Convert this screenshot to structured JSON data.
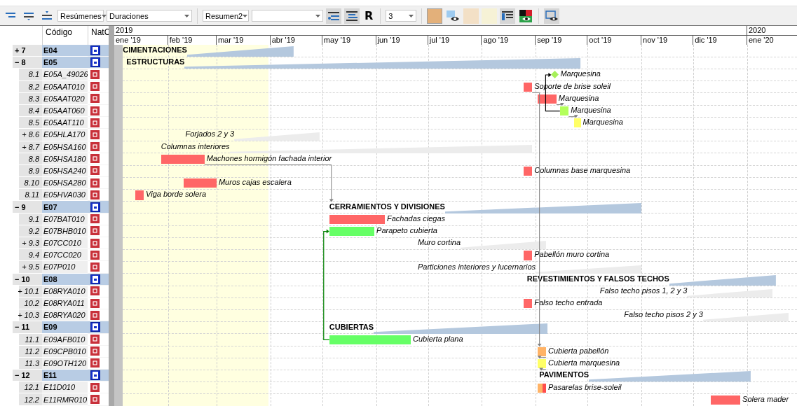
{
  "toolbar": [
    {
      "kind": "icon"
    },
    {
      "kind": "icon"
    },
    {
      "kind": "icon"
    },
    {
      "kind": "select",
      "value": "Resúmenes"
    },
    {
      "kind": "select",
      "value": "Duraciones"
    },
    {
      "kind": "separator"
    },
    {
      "kind": "select",
      "value": "Resumen2"
    },
    {
      "kind": "select"
    },
    {
      "kind": "icon",
      "pressed": true
    },
    {
      "kind": "icon",
      "pressed": true
    },
    {
      "kind": "letter",
      "label": "R"
    },
    {
      "kind": "separator"
    },
    {
      "kind": "select",
      "value": "3"
    },
    {
      "kind": "separator"
    },
    {
      "kind": "swatch",
      "color": "#e3b07a",
      "pressed": true
    },
    {
      "kind": "icon"
    },
    {
      "kind": "swatch",
      "color": "#f3e0c6"
    },
    {
      "kind": "swatch",
      "color": "#f6f2d6"
    },
    {
      "kind": "icon",
      "pressed": true
    },
    {
      "kind": "icon"
    },
    {
      "kind": "separator"
    },
    {
      "kind": "icon",
      "pressed": true
    }
  ],
  "columns": [
    {
      "label": "Código"
    },
    {
      "label": "NatC"
    }
  ],
  "timeline": {
    "years": [
      {
        "label": "2019"
      },
      {
        "label": "2020"
      }
    ],
    "months": [
      {
        "label": "ene '19"
      },
      {
        "label": "feb '19"
      },
      {
        "label": "mar '19"
      },
      {
        "label": "abr '19"
      },
      {
        "label": "may '19"
      },
      {
        "label": "jun '19"
      },
      {
        "label": "jul '19"
      },
      {
        "label": "ago '19"
      },
      {
        "label": "sep '19"
      },
      {
        "label": "oct '19"
      },
      {
        "label": "nov '19"
      },
      {
        "label": "dic '19"
      },
      {
        "label": "ene '20"
      }
    ]
  },
  "rows": [
    {
      "num": "7",
      "code": "E04",
      "expander": "+",
      "kind": "chapter",
      "bar": {
        "kind": "phase",
        "label": "CIMENTACIONES"
      }
    },
    {
      "num": "8",
      "code": "E05",
      "expander": "−",
      "kind": "chapter",
      "bar": {
        "kind": "phase",
        "label": "ESTRUCTURAS"
      }
    },
    {
      "num": "8.1",
      "code": "E05A_49026",
      "kind": "task",
      "bar": {
        "kind": "milestone",
        "color": "#a6f05a",
        "label": "Marquesina"
      }
    },
    {
      "num": "8.2",
      "code": "E05AAT010",
      "kind": "task",
      "bar": {
        "kind": "task",
        "color": "#ff6666",
        "label": "Soporte de brise soleil"
      }
    },
    {
      "num": "8.3",
      "code": "E05AAT020",
      "kind": "task",
      "bar": {
        "kind": "task",
        "color": "#ff6666",
        "label": "Marquesina"
      }
    },
    {
      "num": "8.4",
      "code": "E05AAT060",
      "kind": "task",
      "bar": {
        "kind": "task",
        "color": "#b3ff5a",
        "label": "Marquesina"
      }
    },
    {
      "num": "8.5",
      "code": "E05AAT110",
      "kind": "task",
      "bar": {
        "kind": "task",
        "color": "#ffff66",
        "label": "Marquesina"
      }
    },
    {
      "num": "8.6",
      "code": "E05HLA170",
      "expander": "+",
      "kind": "task",
      "bar": {
        "kind": "group",
        "label": "Forjados 2 y 3"
      }
    },
    {
      "num": "8.7",
      "code": "E05HSA160",
      "expander": "+",
      "kind": "task",
      "bar": {
        "kind": "group",
        "label": "Columnas interiores"
      }
    },
    {
      "num": "8.8",
      "code": "E05HSA180",
      "kind": "task",
      "bar": {
        "kind": "task",
        "color": "#ff6666",
        "label": "Machones hormigón fachada interior"
      }
    },
    {
      "num": "8.9",
      "code": "E05HSA240",
      "kind": "task",
      "bar": {
        "kind": "task",
        "color": "#ff6666",
        "label": "Columnas base marquesina"
      }
    },
    {
      "num": "8.10",
      "code": "E05HSA280",
      "kind": "task",
      "bar": {
        "kind": "task",
        "color": "#ff6666",
        "label": "Muros cajas escalera"
      }
    },
    {
      "num": "8.11",
      "code": "E05HVA030",
      "kind": "task",
      "bar": {
        "kind": "task",
        "color": "#ff6666",
        "label": "Viga borde solera"
      }
    },
    {
      "num": "9",
      "code": "E07",
      "expander": "−",
      "kind": "chapter",
      "bar": {
        "kind": "phase",
        "label": "CERRAMIENTOS Y DIVISIONES"
      }
    },
    {
      "num": "9.1",
      "code": "E07BAT010",
      "kind": "task",
      "bar": {
        "kind": "task",
        "color": "#ff6666",
        "label": "Fachadas ciegas"
      }
    },
    {
      "num": "9.2",
      "code": "E07BHB010",
      "kind": "task",
      "bar": {
        "kind": "task",
        "color": "#66ff66",
        "label": "Parapeto cubierta"
      }
    },
    {
      "num": "9.3",
      "code": "E07CC010",
      "expander": "+",
      "kind": "task",
      "bar": {
        "kind": "group",
        "label": "Muro cortina"
      }
    },
    {
      "num": "9.4",
      "code": "E07CC020",
      "kind": "task",
      "bar": {
        "kind": "task",
        "color": "#ff6666",
        "label": "Pabellón  muro cortina"
      }
    },
    {
      "num": "9.5",
      "code": "E07P010",
      "expander": "+",
      "kind": "task",
      "bar": {
        "kind": "group",
        "label": "Particiones interiores y lucernarios"
      }
    },
    {
      "num": "10",
      "code": "E08",
      "expander": "−",
      "kind": "chapter",
      "bar": {
        "kind": "phase",
        "label": "REVESTIMIENTOS Y FALSOS TECHOS"
      }
    },
    {
      "num": "10.1",
      "code": "E08RYA010",
      "expander": "+",
      "kind": "task",
      "bar": {
        "kind": "group",
        "label": "Falso techo pisos 1, 2 y 3"
      }
    },
    {
      "num": "10.2",
      "code": "E08RYA011",
      "kind": "task",
      "bar": {
        "kind": "task",
        "color": "#ff6666",
        "label": "Falso techo entrada"
      }
    },
    {
      "num": "10.3",
      "code": "E08RYA020",
      "expander": "+",
      "kind": "task",
      "bar": {
        "kind": "group",
        "label": "Falso techo pisos 2 y 3"
      }
    },
    {
      "num": "11",
      "code": "E09",
      "expander": "−",
      "kind": "chapter",
      "bar": {
        "kind": "phase",
        "label": "CUBIERTAS"
      }
    },
    {
      "num": "11.1",
      "code": "E09AFB010",
      "kind": "task",
      "bar": {
        "kind": "task",
        "color": "#66ff66",
        "label": "Cubierta plana"
      }
    },
    {
      "num": "11.2",
      "code": "E09CPB010",
      "kind": "task",
      "bar": {
        "kind": "task",
        "color": "#ffb366",
        "label": "Cubierta pabellón"
      }
    },
    {
      "num": "11.3",
      "code": "E09OTH120",
      "kind": "task",
      "bar": {
        "kind": "task",
        "color": "#ffff66",
        "label": "Cubierta marquesina"
      }
    },
    {
      "num": "12",
      "code": "E11",
      "expander": "−",
      "kind": "chapter",
      "bar": {
        "kind": "phase",
        "label": "PAVIMENTOS"
      }
    },
    {
      "num": "12.1",
      "code": "E11D010",
      "kind": "task",
      "bar": {
        "kind": "task",
        "segments": [
          {
            "color": "#ffb366"
          },
          {
            "color": "#ff4d4d"
          }
        ],
        "label": "Pasarelas brise-soleil"
      }
    },
    {
      "num": "12.2",
      "code": "E11RMR010",
      "kind": "task",
      "bar": {
        "kind": "task",
        "color": "#ff6666",
        "label": "Solera mader"
      }
    }
  ]
}
